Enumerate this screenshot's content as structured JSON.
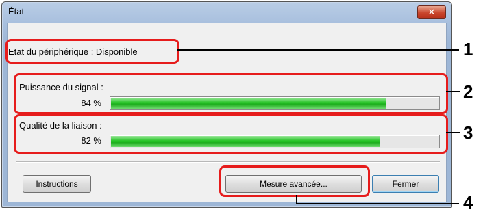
{
  "window": {
    "title": "État",
    "close_glyph": "✕"
  },
  "device_status": {
    "text": "Etat du périphérique : Disponible"
  },
  "signal": {
    "label": "Puissance du signal :",
    "percent_text": "84 %",
    "value": 84
  },
  "link": {
    "label": "Qualité de la liaison :",
    "percent_text": "82 %",
    "value": 82
  },
  "buttons": {
    "instructions": "Instructions",
    "advanced": "Mesure avancée...",
    "close": "Fermer"
  },
  "callouts": [
    "1",
    "2",
    "3",
    "4"
  ],
  "colors": {
    "callout": "#e61c1c",
    "bar_fill": "#24c324"
  }
}
